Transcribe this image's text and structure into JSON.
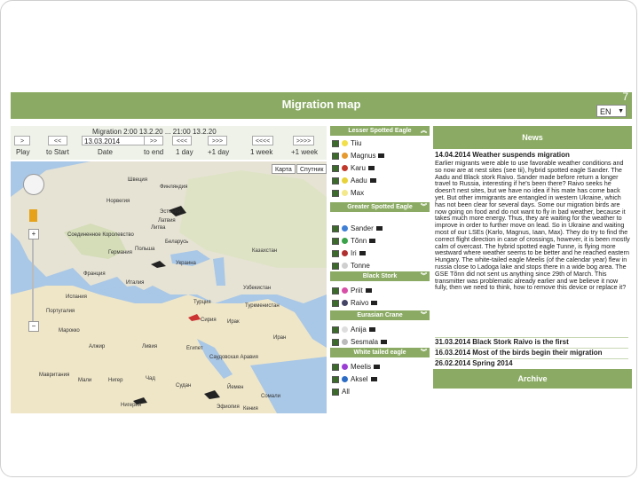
{
  "header": {
    "title": "Migration map",
    "corner_mark": "7",
    "language": "EN"
  },
  "controls": {
    "migration_label": "Migration 2:00 13.2.20 ... 21:00 13.2.20",
    "date_value": "13.03.2014",
    "buttons": [
      ">",
      "<<",
      ">>",
      "<<<",
      ">>>",
      "<<<<",
      ">>>>"
    ],
    "labels": [
      "Play",
      "to Start",
      "Date",
      "to end",
      "1 day",
      "+1 day",
      "1 week",
      "+1 week"
    ]
  },
  "map": {
    "map_btn": "Карта",
    "satellite_btn": "Спутник",
    "labels": [
      "Швеция",
      "Финляндия",
      "Норвегия",
      "Эстония",
      "Латвия",
      "Литва",
      "Соединенное Королевство",
      "Германия",
      "Польша",
      "Беларусь",
      "Украина",
      "Франция",
      "Италия",
      "Испания",
      "Португалия",
      "Казахстан",
      "Узбекистан",
      "Туркменистан",
      "Турция",
      "Сирия",
      "Ирак",
      "Иран",
      "Египет",
      "Ливия",
      "Алжир",
      "Марокко",
      "Мали",
      "Нигер",
      "Чад",
      "Судан",
      "Эфиопия",
      "Нигерия",
      "Саудовская Аравия",
      "Йемен",
      "Мавритания",
      "Сомали",
      "Кения"
    ]
  },
  "birds": {
    "groups": [
      {
        "name": "Lesser Spotted Eagle",
        "birds": [
          {
            "name": "Tiiu",
            "color": "#f2e04a",
            "cam": false
          },
          {
            "name": "Magnus",
            "color": "#e69a2e",
            "cam": true
          },
          {
            "name": "Karu",
            "color": "#c0392b",
            "cam": true
          },
          {
            "name": "Aadu",
            "color": "#e8d23a",
            "cam": true
          },
          {
            "name": "Max",
            "color": "#f3e88a",
            "cam": false
          }
        ]
      },
      {
        "name": "Greater Spotted Eagle",
        "birds": [
          {
            "name": "Sander",
            "color": "#3f7fd4",
            "cam": true
          },
          {
            "name": "Tõnn",
            "color": "#3aa34a",
            "cam": true
          },
          {
            "name": "Iri",
            "color": "#b03030",
            "cam": true
          },
          {
            "name": "Tonne",
            "color": "#cfcfcf",
            "cam": false
          }
        ]
      },
      {
        "name": "Black Stork",
        "birds": [
          {
            "name": "Priit",
            "color": "#d84fa8",
            "cam": true
          },
          {
            "name": "Raivo",
            "color": "#444466",
            "cam": true
          }
        ]
      },
      {
        "name": "Eurasian Crane",
        "birds": [
          {
            "name": "Anija",
            "color": "#dddddd",
            "cam": true
          },
          {
            "name": "Sesmala",
            "color": "#bbbbbb",
            "cam": true
          }
        ]
      },
      {
        "name": "White tailed eagle",
        "birds": [
          {
            "name": "Meelis",
            "color": "#9b3fd4",
            "cam": true
          },
          {
            "name": "Aksel",
            "color": "#2b6cc4",
            "cam": true
          }
        ]
      }
    ],
    "all_label": "All"
  },
  "news": {
    "heading": "News",
    "headline": "14.04.2014 Weather suspends migration",
    "body": "Earlier migrants were able to use favorable weather conditions and so now are at nest sites (see tii), hybrid spotted eagle Sander. The Aadu and Black stork Raivo. Sander made before return a longer travel to Russia, interesting if he's been there? Raivo seeks he doesn't nest sites, but we have no idea if his mate has come back yet. But other immigrants are entangled in western Ukraine, which has not been clear for several days. Some our migration birds are now going on food and do not want to fly in bad weather, because it takes much more energy. Thus, they are waiting for the weather to improve in order to further move on lead. So in Ukraine and waiting most of our LSEs (Karlo, Magnus, Iaan, Max). They do try to find the correct flight direction in case of crossings, however, it is been mostly calm of overcast. The hybrid spotted eagle Tunne, is flying more westward where weather seems to be better and he reached eastern Hungary. The white-tailed eagle Meelis (of the calendar year) flew in russia close to Ladoga lake and stops there in a wide bog area. The GSE Tõnn did not sent us anything since 29th of March. This transmitter was problematic already earlier and we believe it now fully, then we need to think, how to remove this device or replace it?",
    "items": [
      "31.03.2014 Black Stork Raivo is the first",
      "16.03.2014 Most of the birds begin their migration",
      "26.02.2014 Spring 2014"
    ],
    "archive": "Archive"
  }
}
